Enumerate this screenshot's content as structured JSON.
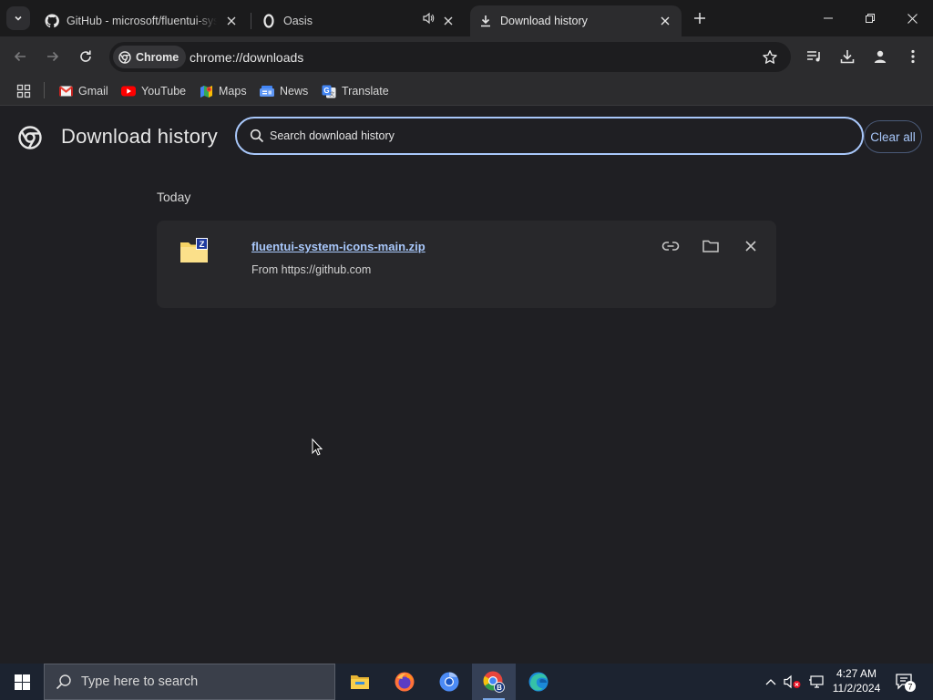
{
  "tabs": [
    {
      "title": "GitHub - microsoft/fluentui-system-icons",
      "icon": "github-icon",
      "active": false
    },
    {
      "title": "Oasis",
      "icon": "opera-icon",
      "active": false,
      "audio": true
    },
    {
      "title": "Download history",
      "icon": "download-icon",
      "active": true
    }
  ],
  "omnibox": {
    "chip_label": "Chrome",
    "url": "chrome://downloads"
  },
  "bookmarks": [
    {
      "label": "Gmail",
      "icon": "gmail-icon"
    },
    {
      "label": "YouTube",
      "icon": "youtube-icon"
    },
    {
      "label": "Maps",
      "icon": "maps-icon"
    },
    {
      "label": "News",
      "icon": "news-icon"
    },
    {
      "label": "Translate",
      "icon": "translate-icon"
    }
  ],
  "page": {
    "title": "Download history",
    "search_placeholder": "Search download history",
    "clear_all_label": "Clear all"
  },
  "downloads": {
    "section_date": "Today",
    "items": [
      {
        "filename": "fluentui-system-icons-main.zip",
        "source": "From https://github.com"
      }
    ]
  },
  "taskbar": {
    "search_placeholder": "Type here to search",
    "time": "4:27 AM",
    "date": "11/2/2024",
    "notification_count": "7"
  },
  "colors": {
    "accent": "#a8c7fa",
    "page_bg": "#1f1f23",
    "card_bg": "#28282b",
    "taskbar_bg": "#1c2330"
  }
}
